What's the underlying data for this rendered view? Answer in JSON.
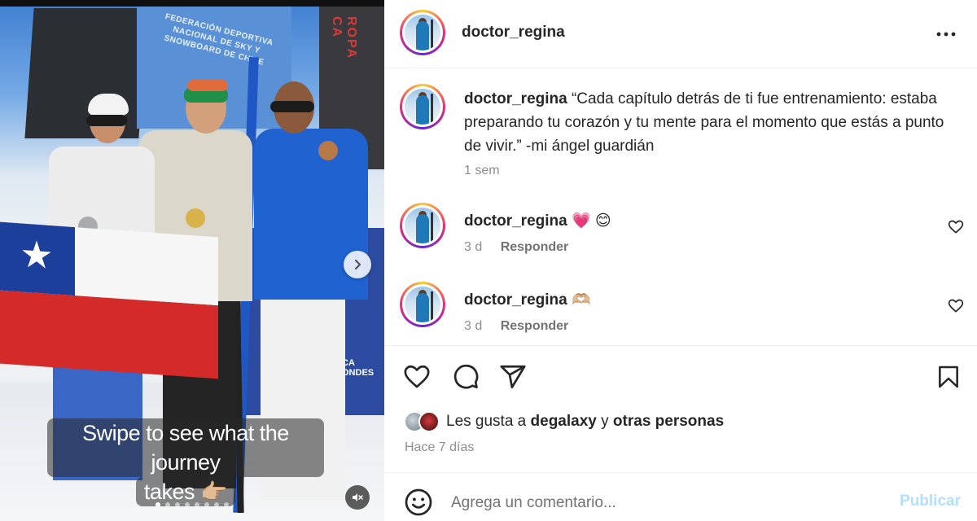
{
  "media": {
    "banner_center_text": "FEDERACIÓN DEPORTIVA NACIONAL DE SKY Y SNOWBOARD DE CHILE",
    "banner_right_text": "ROPA CA",
    "board_text": "CA\nONDES",
    "caption_line1": "Swipe to see what the journey",
    "caption_line2": "takes 👉🏼",
    "carousel_dots": 8,
    "active_dot": 0
  },
  "post": {
    "username": "doctor_regina",
    "caption_text": "“Cada capítulo detrás de ti fue entrenamiento: estaba preparando tu corazón y tu mente para el momento que estás a punto de vivir.” -mi ángel guardián",
    "caption_time": "1 sem"
  },
  "comments": [
    {
      "username": "doctor_regina",
      "text": "💗 😊",
      "time": "3 d",
      "reply_label": "Responder"
    },
    {
      "username": "doctor_regina",
      "text": "🫶🏼",
      "time": "3 d",
      "reply_label": "Responder"
    }
  ],
  "likes": {
    "prefix": "Les gusta a",
    "user": "degalaxy",
    "joiner": "y",
    "others": "otras personas"
  },
  "timestamp": "Hace 7 días",
  "composer": {
    "placeholder": "Agrega un comentario...",
    "publish_label": "Publicar"
  },
  "icons": [
    "heart-icon",
    "comment-icon",
    "share-icon",
    "bookmark-icon",
    "emoji-icon",
    "more-icon",
    "chevron-right-icon",
    "mute-icon"
  ],
  "colors": {
    "publish_disabled": "#b2dffc",
    "meta_gray": "#8e8e8e",
    "text": "#262626"
  }
}
